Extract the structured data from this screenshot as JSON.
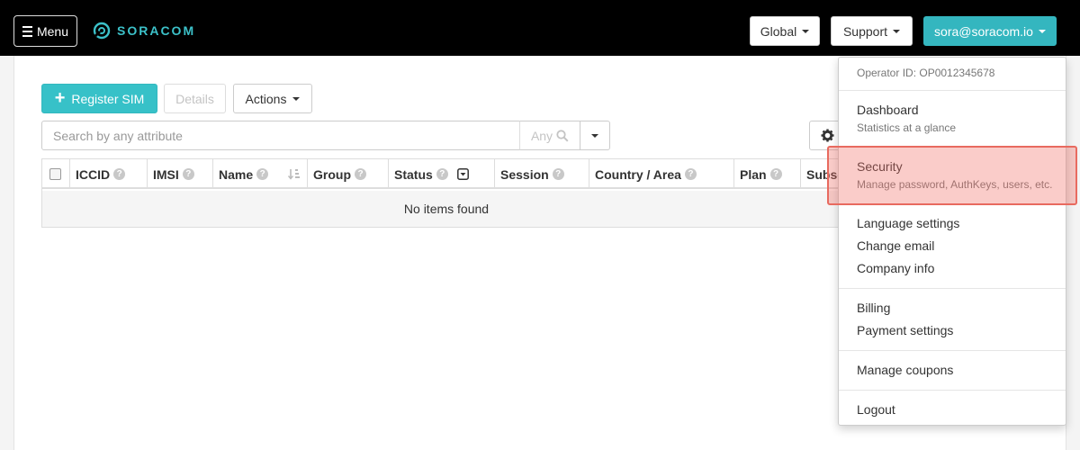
{
  "navbar": {
    "menu_label": "Menu",
    "logo_text": "SORACOM",
    "global_label": "Global",
    "support_label": "Support",
    "user_label": "sora@soracom.io"
  },
  "toolbar": {
    "register_label": "Register SIM",
    "details_label": "Details",
    "actions_label": "Actions"
  },
  "search": {
    "placeholder": "Search by any attribute",
    "scope_label": "Any"
  },
  "table": {
    "columns": [
      "ICCID",
      "IMSI",
      "Name",
      "Group",
      "Status",
      "Session",
      "Country / Area",
      "Plan",
      "Subsc"
    ],
    "empty_message": "No items found"
  },
  "user_menu": {
    "operator_id": "Operator ID: OP0012345678",
    "items": [
      {
        "label": "Dashboard",
        "sub": "Statistics at a glance"
      },
      {
        "label": "Security",
        "sub": "Manage password, AuthKeys, users, etc."
      },
      {
        "label": "Language settings"
      },
      {
        "label": "Change email"
      },
      {
        "label": "Company info"
      },
      {
        "label": "Billing"
      },
      {
        "label": "Payment settings"
      },
      {
        "label": "Manage coupons"
      },
      {
        "label": "Logout"
      }
    ]
  },
  "colors": {
    "accent": "#34b6bf",
    "highlight": "#e86a5f"
  }
}
